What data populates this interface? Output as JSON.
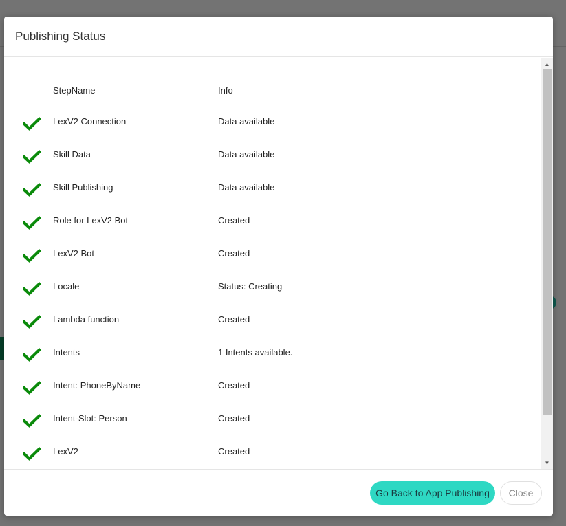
{
  "dialog": {
    "title": "Publishing Status",
    "columns": {
      "step": "StepName",
      "info": "Info"
    },
    "rows": [
      {
        "step": "LexV2 Connection",
        "info": "Data available",
        "status": "check-icon"
      },
      {
        "step": "Skill Data",
        "info": "Data available",
        "status": "check-icon"
      },
      {
        "step": "Skill Publishing",
        "info": "Data available",
        "status": "check-icon"
      },
      {
        "step": "Role for LexV2 Bot",
        "info": "Created",
        "status": "check-icon"
      },
      {
        "step": "LexV2 Bot",
        "info": "Created",
        "status": "check-icon"
      },
      {
        "step": "Locale",
        "info": "Status: Creating",
        "status": "check-icon"
      },
      {
        "step": "Lambda function",
        "info": "Created",
        "status": "check-icon"
      },
      {
        "step": "Intents",
        "info": "1 Intents available.",
        "status": "check-icon"
      },
      {
        "step": "Intent: PhoneByName",
        "info": "Created",
        "status": "check-icon"
      },
      {
        "step": "Intent-Slot: Person",
        "info": "Created",
        "status": "check-icon"
      },
      {
        "step": "LexV2",
        "info": "Created",
        "status": "check-icon"
      }
    ],
    "buttons": {
      "primary": "Go Back to App Publishing",
      "close": "Close"
    }
  },
  "colors": {
    "check": "#0a8a0a",
    "primary_button": "#2ed8c3",
    "overlay": "#6b6b6b"
  }
}
